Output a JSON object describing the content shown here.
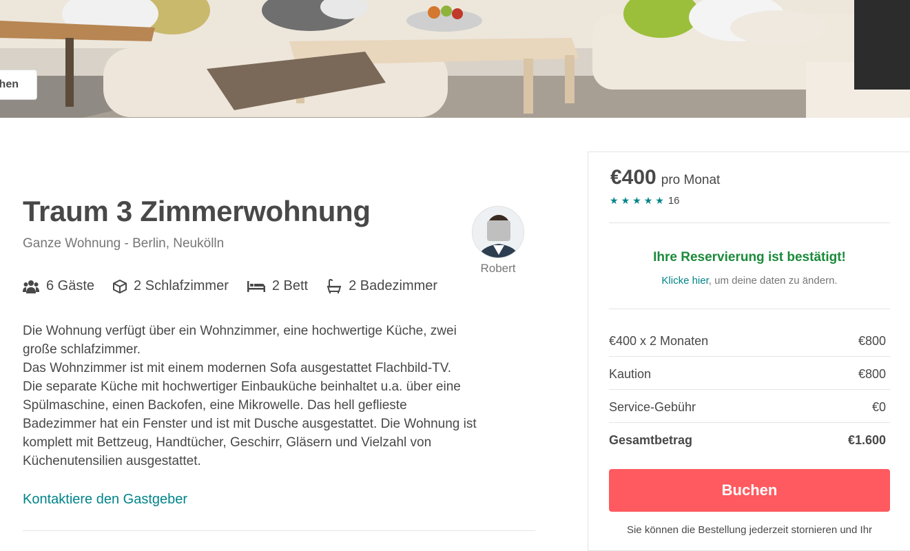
{
  "hero": {
    "button_label": "hen"
  },
  "listing": {
    "title": "Traum 3 Zimmerwohnung",
    "subtitle": "Ganze Wohnung - Berlin, Neukölln",
    "host_name": "Robert",
    "amenities": [
      {
        "icon": "guests-icon",
        "label": "6 Gäste"
      },
      {
        "icon": "cube-icon",
        "label": "2 Schlafzimmer"
      },
      {
        "icon": "bed-icon",
        "label": "2 Bett"
      },
      {
        "icon": "bathtub-icon",
        "label": "2 Badezimmer"
      }
    ],
    "description_lines": [
      "Die Wohnung verfügt über ein Wohnzimmer, eine hochwertige Küche, zwei",
      "große schlafzimmer.",
      "Das Wohnzimmer ist mit einem modernen Sofa ausgestattet Flachbild-TV.",
      "Die separate Küche mit hochwertiger Einbauküche beinhaltet u.a. über eine",
      "Spülmaschine, einen Backofen, eine Mikrowelle. Das hell geflieste",
      "Badezimmer hat ein Fenster und ist mit Dusche ausgestattet. Die Wohnung ist",
      "komplett mit Bettzeug, Handtücher, Geschirr, Gläsern und Vielzahl von",
      "Küchenutensilien ausgestattet."
    ],
    "contact_link": "Kontaktiere den Gastgeber"
  },
  "booking": {
    "price": "€400",
    "price_unit": "pro Monat",
    "stars": 5,
    "review_count": "16",
    "confirm_title": "Ihre Reservierung ist bestätigt!",
    "confirm_link": "Klicke hier",
    "confirm_rest": ", um deine daten zu ändern.",
    "lines": [
      {
        "label": "€400 x 2 Monaten",
        "value": "€800"
      },
      {
        "label": "Kaution",
        "value": "€800"
      },
      {
        "label": "Service-Gebühr",
        "value": "€0"
      },
      {
        "label": "Gesamtbetrag",
        "value": "€1.600"
      }
    ],
    "book_button": "Buchen",
    "cancel_note": "Sie können die Bestellung jederzeit stornieren und Ihr"
  },
  "colors": {
    "accent": "#008489",
    "book_button": "#ff5a5f",
    "confirm_green": "#1b8a3a",
    "text": "#484848"
  }
}
